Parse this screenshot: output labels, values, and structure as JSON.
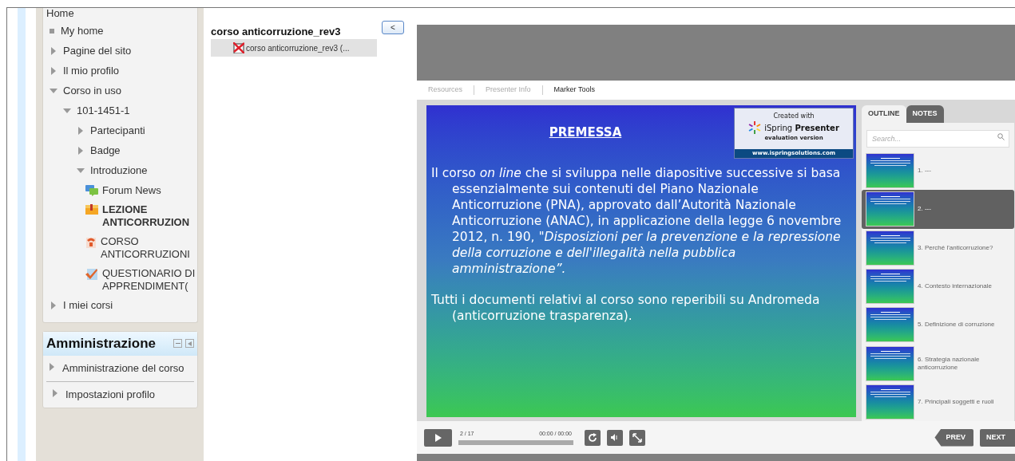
{
  "navigation": {
    "items": [
      {
        "label": "Home",
        "kind": "root"
      },
      {
        "label": "My home",
        "kind": "leaf"
      },
      {
        "label": "Pagine del sito",
        "kind": "branch",
        "expanded": false
      },
      {
        "label": "Il mio profilo",
        "kind": "branch",
        "expanded": false
      },
      {
        "label": "Corso in uso",
        "kind": "branch",
        "expanded": true,
        "children": [
          {
            "label": "101-1451-1",
            "kind": "branch",
            "expanded": true,
            "children": [
              {
                "label": "Partecipanti",
                "kind": "branch",
                "expanded": false
              },
              {
                "label": "Badge",
                "kind": "branch",
                "expanded": false
              },
              {
                "label": "Introduzione",
                "kind": "branch",
                "expanded": true,
                "children": [
                  {
                    "label": "Forum News",
                    "kind": "forum",
                    "active": false
                  },
                  {
                    "label": "LEZIONE ANTICORRUZION",
                    "kind": "lesson",
                    "active": true
                  },
                  {
                    "label": "CORSO ANTICORRUZIONI",
                    "kind": "scorm",
                    "active": false
                  },
                  {
                    "label": "QUESTIONARIO DI APPRENDIMENT(",
                    "kind": "quiz",
                    "active": false
                  }
                ]
              }
            ]
          }
        ]
      },
      {
        "label": "I miei corsi",
        "kind": "branch",
        "expanded": false
      }
    ]
  },
  "administration": {
    "title": "Amministrazione",
    "items": [
      "Amministrazione del corso",
      "Impostazioni profilo"
    ]
  },
  "resource": {
    "title": "corso anticorruzione_rev3",
    "file": "corso anticorruzione_rev3 (...",
    "toggle": "<"
  },
  "player": {
    "tabs": [
      {
        "label": "Resources",
        "selected": false
      },
      {
        "label": "Presenter Info",
        "selected": false
      },
      {
        "label": "Marker Tools",
        "selected": true
      }
    ],
    "slide": {
      "title": "PREMESSA",
      "paragraphs": [
        "Il corso *on line* che si sviluppa nelle diapositive successive si basa essenzialmente sui contenuti del Piano Nazionale Anticorruzione (PNA), approvato dall’Autorità Nazionale Anticorruzione (ANAC), in applicazione della legge 6 novembre 2012, n. 190, *\"Disposizioni per la prevenzione e la repressione della corruzione e dell'illegalità nella pubblica amministrazione”.*",
        "Tutti i documenti relativi al corso sono reperibili su  Andromeda (anticorruzione trasparenza)."
      ],
      "badge": {
        "line1": "Created with",
        "brand": "iSpring",
        "product": "Presenter",
        "line3": "evaluation version",
        "url": "www.ispringsolutions.com"
      }
    },
    "side_tabs": [
      {
        "label": "OUTLINE",
        "selected": true
      },
      {
        "label": "NOTES",
        "selected": false
      }
    ],
    "search": {
      "placeholder": "Search..."
    },
    "outline": [
      {
        "label": "1. ---",
        "selected": false
      },
      {
        "label": "2. ---",
        "selected": true
      },
      {
        "label": "3. Perché l'anticorruzione?",
        "selected": false
      },
      {
        "label": "4. Contesto internazionale",
        "selected": false
      },
      {
        "label": "5. Definizione di corruzione",
        "selected": false
      },
      {
        "label": "6. Strategia nazionale anticorruzione",
        "selected": false
      },
      {
        "label": "7. Principali soggetti e ruoli",
        "selected": false
      }
    ],
    "controls": {
      "counter": "2 / 17",
      "time": "00:00 / 00:00",
      "prev": "PREV",
      "next": "NEXT"
    }
  }
}
